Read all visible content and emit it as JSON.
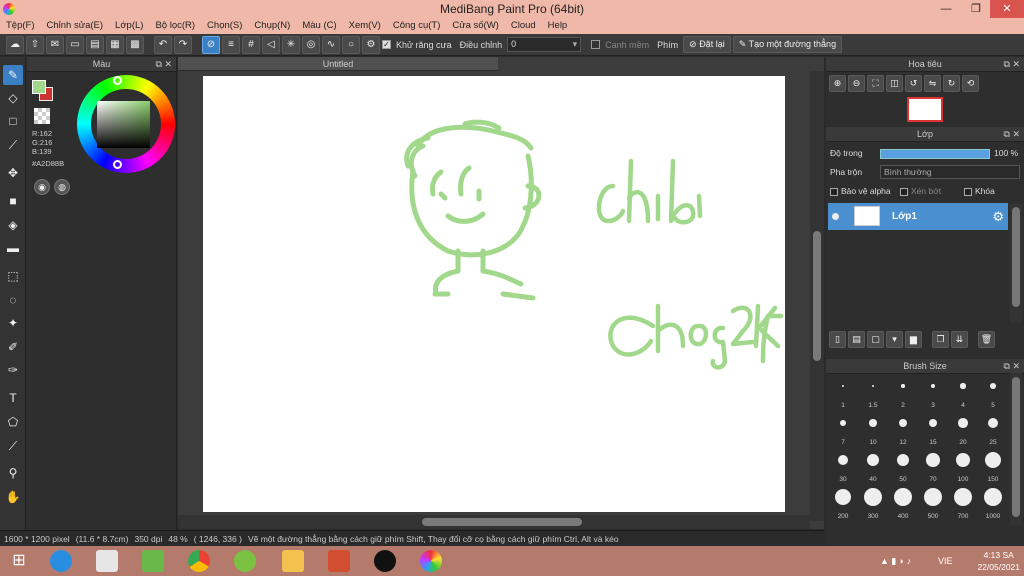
{
  "window": {
    "title": "MediBang Paint Pro (64bit)"
  },
  "menu": [
    "Tệp(F)",
    "Chỉnh sửa(E)",
    "Lớp(L)",
    "Bộ lọc(R)",
    "Chọn(S)",
    "Chụp(N)",
    "Màu (C)",
    "Xem(V)",
    "Công cụ(T)",
    "Cửa số(W)",
    "Cloud",
    "Help"
  ],
  "toolbar": {
    "antialias_label": "Khử răng cưa",
    "adjust_label": "Điều chỉnh",
    "adjust_value": "0",
    "edge_label": "Canh mềm",
    "key_label": "Phím",
    "reset_label": "Đặt lại",
    "straight_line_label": "Tạo một đường thẳng"
  },
  "color_panel": {
    "title": "Màu",
    "r": "R:162",
    "g": "G:216",
    "b": "B:139",
    "hex": "#A2D88B",
    "main_color": "#A2D88B"
  },
  "document": {
    "tab": "Untitled"
  },
  "drawing": {
    "text1": "chibi",
    "text2": "Chang2k7"
  },
  "status": {
    "size": "1600 * 1200 pixel",
    "cm": "(11.6 * 8.7cm)",
    "dpi": "350 dpi",
    "zoom": "48 %",
    "coords": "( 1246, 336 )",
    "hint": "Vẽ một đường thẳng bằng cách giữ phím Shift, Thay đổi cỡ cọ bằng cách giữ phím Ctrl, Alt và kéo"
  },
  "navigator": {
    "title": "Hoa tiêu"
  },
  "layer_panel": {
    "title": "Lớp",
    "opacity_label": "Độ trong",
    "opacity_value": "100 %",
    "opacity_fraction": 1.0,
    "blend_label": "Pha trộn",
    "blend_value": "Bình thường",
    "protect_alpha": "Bảo vệ alpha",
    "clip": "Xén bớt",
    "lock": "Khóa",
    "layer_name": "Lớp1"
  },
  "brush_size": {
    "title": "Brush Size",
    "sizes": [
      "1",
      "1.5",
      "2",
      "3",
      "4",
      "5",
      "7",
      "10",
      "12",
      "15",
      "20",
      "25",
      "30",
      "40",
      "50",
      "70",
      "100",
      "150",
      "200",
      "300",
      "400",
      "500",
      "700",
      "1000"
    ]
  },
  "taskbar": {
    "lang": "VIE",
    "time": "4:13 SA",
    "date": "22/05/2021"
  }
}
